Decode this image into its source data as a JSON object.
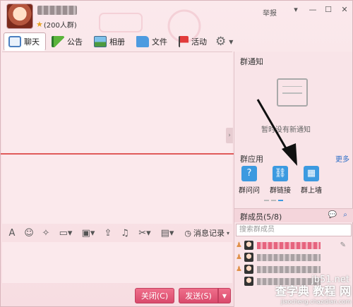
{
  "header": {
    "member_count": "(200人群)",
    "report": "举报"
  },
  "tabs": [
    {
      "label": "聊天",
      "icon": "chat-icon"
    },
    {
      "label": "公告",
      "icon": "announcement-icon"
    },
    {
      "label": "相册",
      "icon": "photo-album-icon"
    },
    {
      "label": "文件",
      "icon": "folder-icon"
    },
    {
      "label": "活动",
      "icon": "flag-icon"
    }
  ],
  "toolbar": {
    "history": "消息记录"
  },
  "buttons": {
    "close": "关闭(C)",
    "send": "发送(S)"
  },
  "right_panel": {
    "notice_title": "群通知",
    "notice_empty": "暂时没有新通知",
    "apps_title": "群应用",
    "apps_more": "更多",
    "apps": [
      {
        "label": "群问问",
        "icon": "qa-icon"
      },
      {
        "label": "群链接",
        "icon": "link-icon"
      },
      {
        "label": "群上墙",
        "icon": "wall-icon"
      }
    ],
    "members_title": "群成员(5/8)",
    "members_search_placeholder": "搜索群成员"
  },
  "watermark": {
    "site": "jb51.net",
    "main": "查字典 教程 网",
    "sub": "jiaocheng.chazidian.com"
  },
  "colors": {
    "accent": "#d94a6c",
    "divider": "#e05a5a",
    "link": "#2f6fc7"
  }
}
